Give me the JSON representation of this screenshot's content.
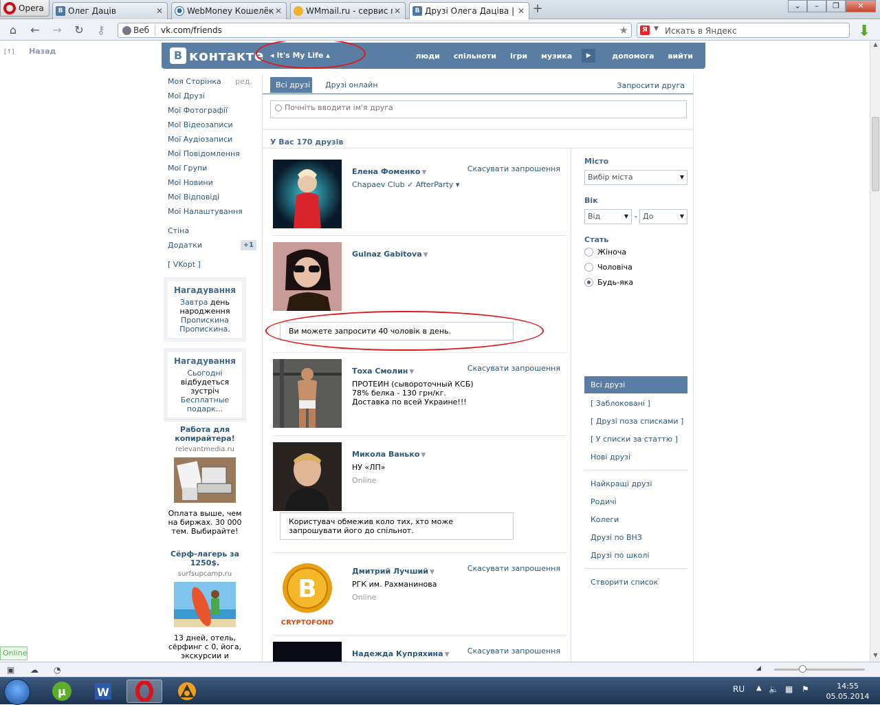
{
  "browser": {
    "menu_label": "Opera",
    "tabs": [
      {
        "icon": "vk",
        "label": "Олег Дацiв"
      },
      {
        "icon": "webmoney",
        "label": "WebMoney Кошелёк »..."
      },
      {
        "icon": "wmmail",
        "label": "WMmail.ru - сервис п..."
      },
      {
        "icon": "vk",
        "label": "Друзi Олега Дацiва | 1..."
      }
    ],
    "address_prefix": "Веб",
    "url": "vk.com/friends",
    "search_engine_letter": "Я",
    "search_placeholder": "Искать в Яндекс"
  },
  "page": {
    "back_icon": "[↑]",
    "back_label": "Назад",
    "logo_letter": "В",
    "logo_text": "контакте",
    "player_label": "◂ It's My Life ▴",
    "top_menu": [
      "люди",
      "спільноти",
      "ігри",
      "музика",
      "допомога",
      "вийти"
    ],
    "left_menu": [
      {
        "label": "Моя Сторінка",
        "extra": "ред."
      },
      {
        "label": "Мої Друзі"
      },
      {
        "label": "Мої Фотографії"
      },
      {
        "label": "Мої Відеозаписи"
      },
      {
        "label": "Мої Аудіозаписи"
      },
      {
        "label": "Мої Повідомлення"
      },
      {
        "label": "Мої Групи"
      },
      {
        "label": "Мої Новини"
      },
      {
        "label": "Мої Відповіді"
      },
      {
        "label": "Мої Налаштування"
      }
    ],
    "left_menu2": [
      {
        "label": "Стіна"
      },
      {
        "label": "Додатки",
        "count": "+1"
      }
    ],
    "vkopt": "[ VKopt ]",
    "reminder1": {
      "title": "Нагадування",
      "l1": "Завтра",
      "t1": " день народження ",
      "l2": "Пропискина Пропискина",
      "t2": "."
    },
    "reminder2": {
      "title": "Нагадування",
      "l1": "Сьогодні",
      "t1": " відбудеться зустріч ",
      "l2": "Бесплатные подарк..."
    },
    "ads": [
      {
        "title": "Работа для копирайтера!",
        "domain": "relevantmedia.ru",
        "text": "Оплата выше, чем на биржах. 30 000 тем. Выбирайте!"
      },
      {
        "title": "Сёрф-лагерь за 1250$.",
        "domain": "surfsupcamp.ru",
        "text": "13 дней, отель, сёрфинг с 0, йога, экскурсии и"
      }
    ]
  },
  "friends_page": {
    "tab_all": "Всі друзі",
    "tab_online": "Друзі онлайн",
    "invite": "Запросити друга",
    "search_placeholder": "Почніть вводити ім'я друга",
    "summary": "У Вас 170 друзів",
    "cancel_label": "Скасувати запрошення",
    "online_label": "Online",
    "friends": [
      {
        "name": "Елена Фоменко",
        "info": "Chapaev Club ✓ AfterParty ▾",
        "cancel": true
      },
      {
        "name": "Gulnaz Gabitova",
        "info": "",
        "cancel": false
      },
      {
        "name": "Тоха Смолин",
        "info": "ПРОТЕИН (сывороточный КСБ) 78% белка - 130 грн/кг. Доставка по всей Украине!!!",
        "cancel": true
      },
      {
        "name": "Микола Ванько",
        "info": "НУ «ЛП»",
        "online": true,
        "cancel": false
      },
      {
        "name": "Дмитрий Лучший",
        "info": "РГК им. Рахманинова",
        "online": true,
        "cancel": true
      },
      {
        "name": "Надежда Купряхина",
        "info": "",
        "cancel": true
      }
    ],
    "notice1": "Ви можете запросити 40 чоловік в день.",
    "notice2": "Користувач обмежив коло тих, хто може запрошувати його до спільнот.",
    "crypto_label": "CRYPTOFOND",
    "filters": {
      "city_label": "Місто",
      "city_placeholder": "Вибір міста",
      "age_label": "Вік",
      "age_from": "Від",
      "age_dash": "-",
      "age_to": "До",
      "sex_label": "Стать",
      "sex_options": [
        "Жіноча",
        "Чоловіча",
        "Будь-яка"
      ],
      "sex_selected": "Будь-яка",
      "lists_current": "Всі друзі",
      "lists1": [
        "[ Заблоковані ]",
        "[ Друзі поза списками ]",
        "[ У списки за статтю ]",
        "Нові друзі"
      ],
      "lists2": [
        "Найкращі друзі",
        "Родичі",
        "Колеги",
        "Друзі по ВНЗ",
        "Друзі по школі"
      ],
      "create_list": "Створити список"
    }
  },
  "status": {
    "online_badge": "Online"
  },
  "taskbar": {
    "lang": "RU",
    "time": "14:55",
    "date": "05.05.2014"
  }
}
